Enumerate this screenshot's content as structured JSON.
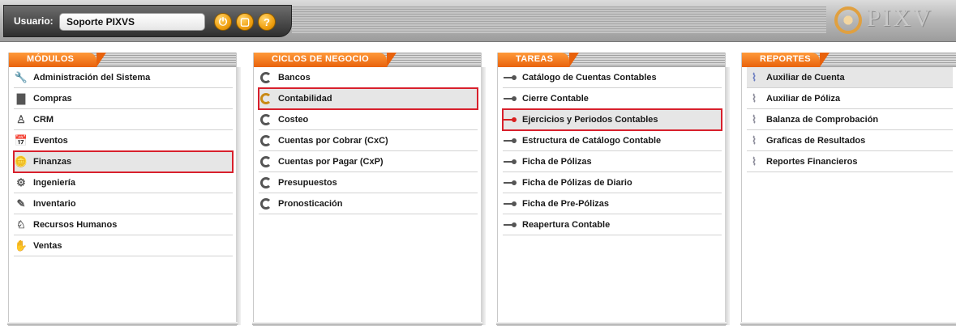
{
  "header": {
    "user_label": "Usuario:",
    "user_value": "Soporte PIXVS",
    "buttons": [
      {
        "name": "power-icon",
        "glyph": "⏻"
      },
      {
        "name": "window-icon",
        "glyph": "▢"
      },
      {
        "name": "help-icon",
        "glyph": "?"
      }
    ],
    "brand_text": "PIXV"
  },
  "columns": [
    {
      "title": "MÓDULOS",
      "items": [
        {
          "label": "Administración del Sistema",
          "icon": "tools-icon",
          "glyph": "🔧"
        },
        {
          "label": "Compras",
          "icon": "box-icon",
          "glyph": "▇"
        },
        {
          "label": "CRM",
          "icon": "person-icon",
          "glyph": "♙"
        },
        {
          "label": "Eventos",
          "icon": "calendar-icon",
          "glyph": "📅"
        },
        {
          "label": "Finanzas",
          "icon": "coins-icon",
          "glyph": "🪙"
        },
        {
          "label": "Ingeniería",
          "icon": "gears-icon",
          "glyph": "⚙"
        },
        {
          "label": "Inventario",
          "icon": "pencil-icon",
          "glyph": "✎"
        },
        {
          "label": "Recursos Humanos",
          "icon": "user-icon",
          "glyph": "♘"
        },
        {
          "label": "Ventas",
          "icon": "hand-icon",
          "glyph": "✋"
        }
      ]
    },
    {
      "title": "CICLOS DE NEGOCIO",
      "items": [
        {
          "label": "Bancos",
          "icon": "cycle-icon"
        },
        {
          "label": "Contabilidad",
          "icon": "cycle-icon"
        },
        {
          "label": "Costeo",
          "icon": "cycle-icon"
        },
        {
          "label": "Cuentas por Cobrar (CxC)",
          "icon": "cycle-icon"
        },
        {
          "label": "Cuentas por Pagar (CxP)",
          "icon": "cycle-icon"
        },
        {
          "label": "Presupuestos",
          "icon": "cycle-icon"
        },
        {
          "label": "Pronosticación",
          "icon": "cycle-icon"
        }
      ]
    },
    {
      "title": "TAREAS",
      "items": [
        {
          "label": "Catálogo de Cuentas Contables",
          "icon": "pin-icon"
        },
        {
          "label": "Cierre Contable",
          "icon": "pin-icon"
        },
        {
          "label": "Ejercicios y Periodos Contables",
          "icon": "pin-icon"
        },
        {
          "label": "Estructura de Catálogo Contable",
          "icon": "pin-icon"
        },
        {
          "label": "Ficha de Pólizas",
          "icon": "pin-icon"
        },
        {
          "label": "Ficha de Pólizas de Diario",
          "icon": "pin-icon"
        },
        {
          "label": "Ficha de Pre-Pólizas",
          "icon": "pin-icon"
        },
        {
          "label": "Reapertura Contable",
          "icon": "pin-icon"
        }
      ]
    },
    {
      "title": "REPORTES",
      "items": [
        {
          "label": "Auxiliar de Cuenta",
          "icon": "paperclip-icon"
        },
        {
          "label": "Auxiliar de Póliza",
          "icon": "paperclip-icon"
        },
        {
          "label": "Balanza de Comprobación",
          "icon": "paperclip-icon"
        },
        {
          "label": "Graficas de Resultados",
          "icon": "paperclip-icon"
        },
        {
          "label": "Reportes Financieros",
          "icon": "paperclip-icon"
        }
      ]
    }
  ],
  "selection": {
    "modulos": "Finanzas",
    "ciclos": "Contabilidad",
    "tareas": "Ejercicios y Periodos Contables",
    "reportes_highlight": "Auxiliar de Cuenta"
  },
  "colors": {
    "tab_orange": "#e8620c",
    "highlight_red": "#d8202c",
    "accent_gold": "#f0a010"
  }
}
